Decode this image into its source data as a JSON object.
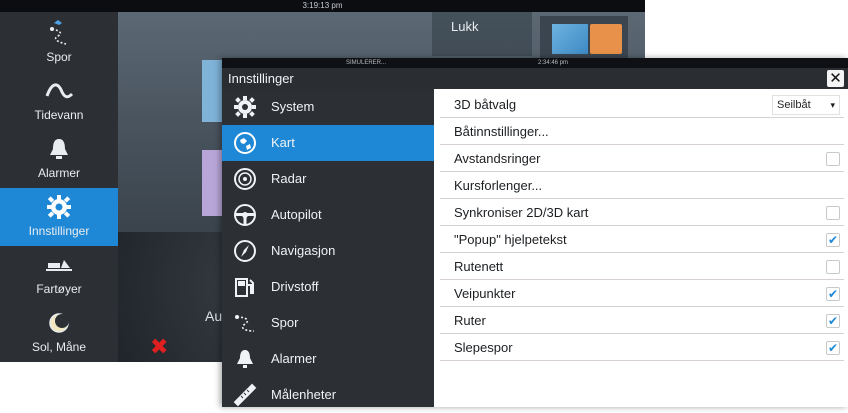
{
  "background": {
    "status_time": "3:19:13 pm",
    "close_label": "Lukk",
    "partial_label": "Au",
    "side_menu": [
      {
        "label": "Spor",
        "icon": "track-icon"
      },
      {
        "label": "Tidevann",
        "icon": "tide-wave-icon"
      },
      {
        "label": "Alarmer",
        "icon": "bell-icon"
      },
      {
        "label": "Innstillinger",
        "icon": "gear-icon",
        "active": true
      },
      {
        "label": "Fartøyer",
        "icon": "vessels-icon"
      },
      {
        "label": "Sol, Måne",
        "icon": "sun-moon-icon"
      }
    ]
  },
  "dialog": {
    "status_left": "SIMULERER...",
    "status_time": "2:34:46 pm",
    "title": "Innstillinger",
    "close_glyph": "✕",
    "categories": [
      {
        "label": "System",
        "icon": "gear-icon"
      },
      {
        "label": "Kart",
        "icon": "chart-globe-icon",
        "active": true
      },
      {
        "label": "Radar",
        "icon": "radar-icon"
      },
      {
        "label": "Autopilot",
        "icon": "steering-wheel-icon"
      },
      {
        "label": "Navigasjon",
        "icon": "compass-icon"
      },
      {
        "label": "Drivstoff",
        "icon": "fuel-pump-icon"
      },
      {
        "label": "Spor",
        "icon": "track-icon"
      },
      {
        "label": "Alarmer",
        "icon": "bell-icon"
      },
      {
        "label": "Målenheter",
        "icon": "ruler-icon"
      }
    ],
    "settings": [
      {
        "label": "3D båtvalg",
        "type": "select",
        "value": "Seilbåt"
      },
      {
        "label": "Båtinnstillinger...",
        "type": "action"
      },
      {
        "label": "Avstandsringer",
        "type": "checkbox",
        "checked": false
      },
      {
        "label": "Kursforlenger...",
        "type": "action"
      },
      {
        "label": "Synkroniser 2D/3D kart",
        "type": "checkbox",
        "checked": false
      },
      {
        "label": "\"Popup\" hjelpetekst",
        "type": "checkbox",
        "checked": true
      },
      {
        "label": "Rutenett",
        "type": "checkbox",
        "checked": false
      },
      {
        "label": "Veipunkter",
        "type": "checkbox",
        "checked": true
      },
      {
        "label": "Ruter",
        "type": "checkbox",
        "checked": true
      },
      {
        "label": "Slepespor",
        "type": "checkbox",
        "checked": true
      }
    ],
    "check_glyph": "✔"
  },
  "colors": {
    "accent": "#1e88d6",
    "sidebar_bg": "#2c3035",
    "titlebar_bg": "#2a2d31",
    "divider": "#d8d1d4"
  }
}
